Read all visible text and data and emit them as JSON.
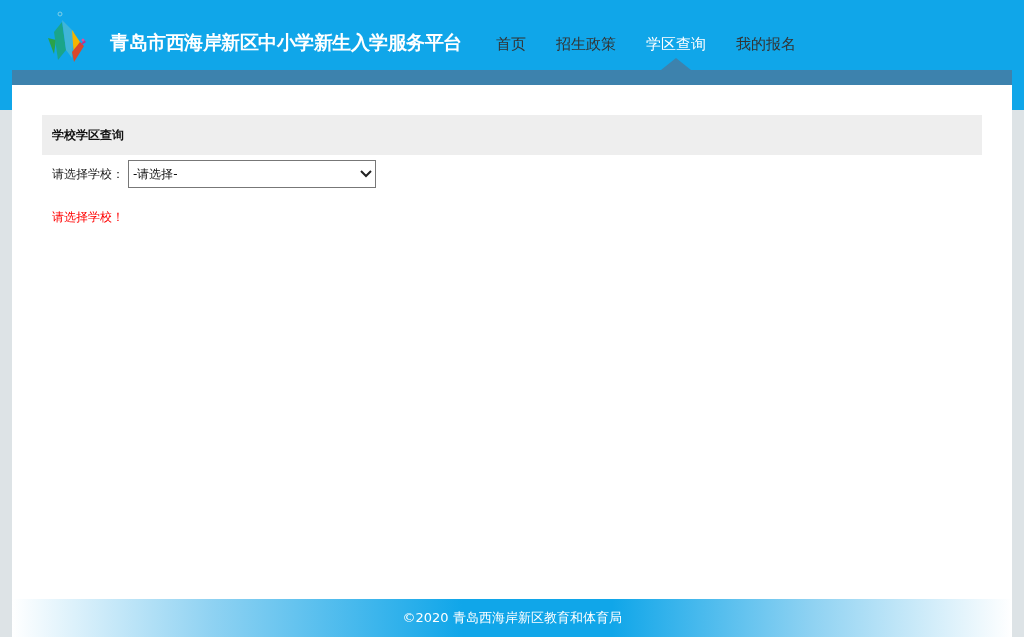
{
  "site_title": "青岛市西海岸新区中小学新生入学服务平台",
  "nav": [
    {
      "label": "首页",
      "selected": false
    },
    {
      "label": "招生政策",
      "selected": false
    },
    {
      "label": "学区查询",
      "selected": true
    },
    {
      "label": "我的报名",
      "selected": false
    }
  ],
  "panel": {
    "title": "学校学区查询",
    "field_label": "请选择学校：",
    "select_value": "-请选择-",
    "error": "请选择学校！"
  },
  "footer": "©2020 青岛西海岸新区教育和体育局"
}
